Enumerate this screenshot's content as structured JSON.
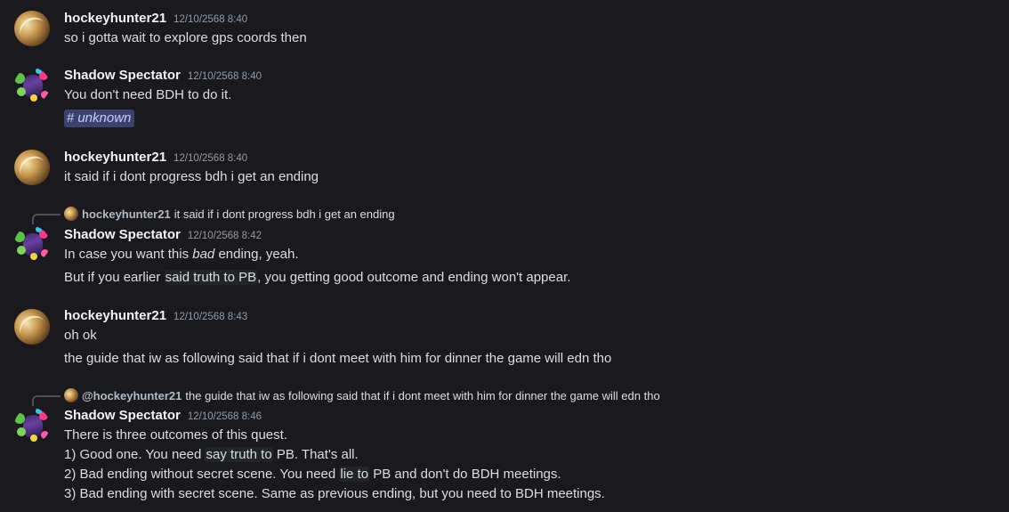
{
  "messages": [
    {
      "author": "hockeyhunter21",
      "timestamp": "12/10/2568 8:40",
      "avatar_icon": "golden-streak-avatar",
      "lines": [
        "so i gotta wait to explore gps coords then"
      ]
    },
    {
      "author": "Shadow Spectator",
      "timestamp": "12/10/2568 8:40",
      "avatar_icon": "clover-character-avatar",
      "lines": [
        "You don't need BDH to do it."
      ],
      "channel_mention": {
        "hash": "#",
        "name": "unknown"
      }
    },
    {
      "author": "hockeyhunter21",
      "timestamp": "12/10/2568 8:40",
      "avatar_icon": "golden-streak-avatar",
      "lines": [
        "it said if i dont progress bdh i get an ending"
      ]
    },
    {
      "reply": {
        "author": "hockeyhunter21",
        "text": "it said if i dont progress bdh i get an ending"
      },
      "author": "Shadow Spectator",
      "timestamp": "12/10/2568 8:42",
      "avatar_icon": "clover-character-avatar",
      "line1": {
        "a": "In case you want this ",
        "em": "bad",
        "b": " ending, yeah."
      },
      "line2": {
        "a": "But if you earlier ",
        "hl": "said truth to PB",
        "b": ", you getting good outcome and ending won't appear."
      }
    },
    {
      "author": "hockeyhunter21",
      "timestamp": "12/10/2568 8:43",
      "avatar_icon": "golden-streak-avatar",
      "lines": [
        "oh ok",
        "the guide that iw as following said that if i dont meet with him for dinner the game will edn tho"
      ]
    },
    {
      "reply": {
        "author": "@hockeyhunter21",
        "text": "the guide that iw as following said that if i dont meet with him for dinner the game will edn tho"
      },
      "author": "Shadow Spectator",
      "timestamp": "12/10/2568 8:46",
      "avatar_icon": "clover-character-avatar",
      "line1": "There is three outcomes of this quest.",
      "line2": {
        "a": "1) Good one. You need ",
        "hl": "say truth to",
        "b": " PB. That's all."
      },
      "line3": {
        "a": "2) Bad ending without secret scene. You need ",
        "hl": "lie to",
        "b": " PB and don't do BDH meetings."
      },
      "line4": "3) Bad ending with secret scene. Same as previous ending, but you need to BDH meetings."
    }
  ],
  "colors": {
    "background": "#1a1a1e",
    "username": "#f2f3f5",
    "timestamp": "#949ba4",
    "text": "#dbdee1",
    "channel_mention_bg": "#3c4270",
    "channel_mention_fg": "#c9cdfb"
  }
}
